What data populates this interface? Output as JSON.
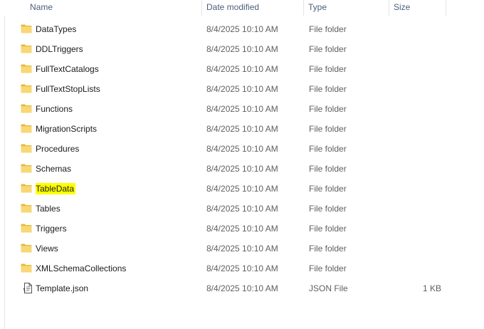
{
  "columns": {
    "name": "Name",
    "date": "Date modified",
    "type": "Type",
    "size": "Size"
  },
  "rows": [
    {
      "name": "DataTypes",
      "date": "8/4/2025 10:10 AM",
      "type": "File folder",
      "size": ""
    },
    {
      "name": "DDLTriggers",
      "date": "8/4/2025 10:10 AM",
      "type": "File folder",
      "size": ""
    },
    {
      "name": "FullTextCatalogs",
      "date": "8/4/2025 10:10 AM",
      "type": "File folder",
      "size": ""
    },
    {
      "name": "FullTextStopLists",
      "date": "8/4/2025 10:10 AM",
      "type": "File folder",
      "size": ""
    },
    {
      "name": "Functions",
      "date": "8/4/2025 10:10 AM",
      "type": "File folder",
      "size": ""
    },
    {
      "name": "MigrationScripts",
      "date": "8/4/2025 10:10 AM",
      "type": "File folder",
      "size": ""
    },
    {
      "name": "Procedures",
      "date": "8/4/2025 10:10 AM",
      "type": "File folder",
      "size": ""
    },
    {
      "name": "Schemas",
      "date": "8/4/2025 10:10 AM",
      "type": "File folder",
      "size": ""
    },
    {
      "name": "TableData",
      "date": "8/4/2025 10:10 AM",
      "type": "File folder",
      "size": ""
    },
    {
      "name": "Tables",
      "date": "8/4/2025 10:10 AM",
      "type": "File folder",
      "size": ""
    },
    {
      "name": "Triggers",
      "date": "8/4/2025 10:10 AM",
      "type": "File folder",
      "size": ""
    },
    {
      "name": "Views",
      "date": "8/4/2025 10:10 AM",
      "type": "File folder",
      "size": ""
    },
    {
      "name": "XMLSchemaCollections",
      "date": "8/4/2025 10:10 AM",
      "type": "File folder",
      "size": ""
    },
    {
      "name": "Template.json",
      "date": "8/4/2025 10:10 AM",
      "type": "JSON File",
      "size": "1 KB"
    }
  ],
  "icons": {
    "folder": "folder-icon",
    "json_file": "json-file-icon"
  },
  "colors": {
    "folder_fill": "#f8d775",
    "folder_back": "#e8b838",
    "highlight": "#ffff00",
    "header_text": "#4c607a",
    "secondary_text": "#5f5f5f"
  }
}
